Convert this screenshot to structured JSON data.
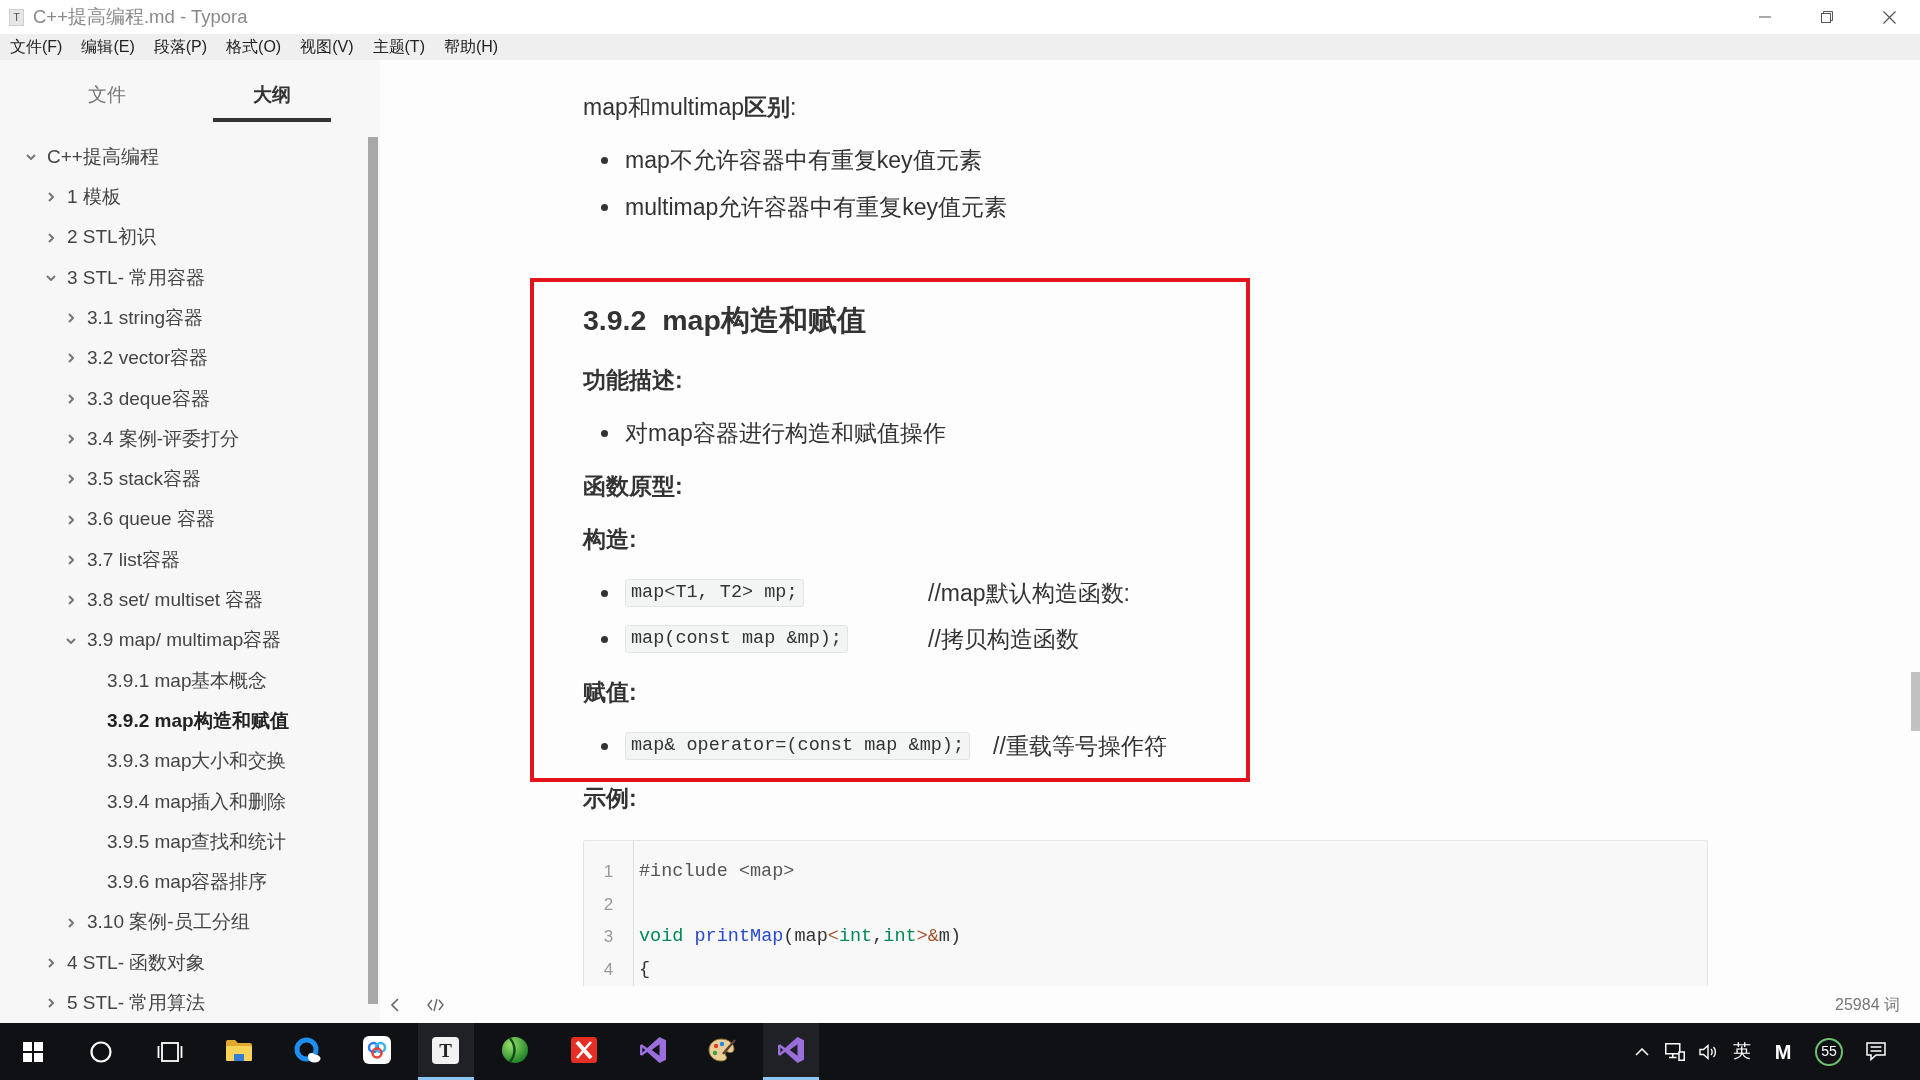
{
  "window": {
    "icon_letter": "T",
    "title": "C++提高编程.md - Typora"
  },
  "menu": [
    "文件(F)",
    "编辑(E)",
    "段落(P)",
    "格式(O)",
    "视图(V)",
    "主题(T)",
    "帮助(H)"
  ],
  "sidebar": {
    "tabs": [
      {
        "label": "文件",
        "selected": false
      },
      {
        "label": "大纲",
        "selected": true
      }
    ],
    "outline": [
      {
        "label": "C++提高编程",
        "expanded": true,
        "selected": false,
        "children": [
          {
            "label": "1 模板",
            "expanded": false,
            "selected": false
          },
          {
            "label": "2 STL初识",
            "expanded": false,
            "selected": false
          },
          {
            "label": "3 STL- 常用容器",
            "expanded": true,
            "selected": false,
            "children": [
              {
                "label": "3.1 string容器",
                "expanded": false,
                "selected": false
              },
              {
                "label": "3.2 vector容器",
                "expanded": false,
                "selected": false
              },
              {
                "label": "3.3 deque容器",
                "expanded": false,
                "selected": false
              },
              {
                "label": "3.4 案例-评委打分",
                "expanded": false,
                "selected": false
              },
              {
                "label": "3.5 stack容器",
                "expanded": false,
                "selected": false
              },
              {
                "label": "3.6 queue 容器",
                "expanded": false,
                "selected": false
              },
              {
                "label": "3.7 list容器",
                "expanded": false,
                "selected": false
              },
              {
                "label": "3.8 set/ multiset 容器",
                "expanded": false,
                "selected": false
              },
              {
                "label": "3.9 map/ multimap容器",
                "expanded": true,
                "selected": false,
                "children": [
                  {
                    "label": "3.9.1 map基本概念",
                    "selected": false
                  },
                  {
                    "label": "3.9.2 map构造和赋值",
                    "selected": true
                  },
                  {
                    "label": "3.9.3 map大小和交换",
                    "selected": false
                  },
                  {
                    "label": "3.9.4 map插入和删除",
                    "selected": false
                  },
                  {
                    "label": "3.9.5 map查找和统计",
                    "selected": false
                  },
                  {
                    "label": "3.9.6 map容器排序",
                    "selected": false
                  }
                ]
              },
              {
                "label": "3.10 案例-员工分组",
                "expanded": false,
                "selected": false
              }
            ]
          },
          {
            "label": "4 STL- 函数对象",
            "expanded": false,
            "selected": false
          },
          {
            "label": "5 STL- 常用算法",
            "expanded": false,
            "selected": false
          }
        ]
      }
    ]
  },
  "document": {
    "blocks": [
      {
        "kind": "paragraph",
        "text": "map和multimap**区别**:"
      },
      {
        "kind": "bullets",
        "items": [
          "map不允许容器中有重复key值元素",
          "multimap允许容器中有重复key值元素"
        ]
      },
      {
        "kind": "frame",
        "blocks": [
          {
            "kind": "heading",
            "text": "3.9.2  map构造和赋值"
          },
          {
            "kind": "label",
            "text": "功能描述:"
          },
          {
            "kind": "bullets",
            "items": [
              "对map容器进行构造和赋值操作"
            ]
          },
          {
            "kind": "label",
            "text": "函数原型:"
          },
          {
            "kind": "label",
            "text": "构造:"
          },
          {
            "kind": "code_bullets",
            "items": [
              {
                "code": "map<T1, T2> mp;",
                "comment": "//map默认构造函数:"
              },
              {
                "code": "map(const map &mp);",
                "comment": "//拷贝构造函数"
              }
            ]
          },
          {
            "kind": "label",
            "text": "赋值:"
          },
          {
            "kind": "code_bullets",
            "items": [
              {
                "code": "map& operator=(const map &mp);",
                "comment": "//重载等号操作符"
              }
            ]
          }
        ]
      },
      {
        "kind": "label",
        "text": "示例:"
      },
      {
        "kind": "code_block",
        "lines": [
          {
            "number": "1",
            "tokens": [
              {
                "kind": "meta",
                "text": "#include <map>"
              }
            ]
          },
          {
            "number": "2"
          },
          {
            "number": "3",
            "tokens": [
              {
                "kind": "type",
                "text": "void "
              },
              {
                "kind": "def",
                "text": "printMap"
              },
              {
                "kind": "plain",
                "text": "(map"
              },
              {
                "kind": "operator",
                "text": "<"
              },
              {
                "kind": "type",
                "text": "int"
              },
              {
                "kind": "plain",
                "text": ","
              },
              {
                "kind": "type",
                "text": "int"
              },
              {
                "kind": "operator",
                "text": ">&"
              },
              {
                "kind": "plain",
                "text": "m)"
              }
            ]
          },
          {
            "number": "4",
            "tokens": [
              {
                "kind": "plain",
                "text": "{"
              }
            ]
          }
        ]
      }
    ]
  },
  "footer": {
    "word_count": "25984 词"
  },
  "taskbar": {
    "apps": [
      {
        "kind": "folder",
        "active": false
      },
      {
        "kind": "ring_browser",
        "active": false
      },
      {
        "kind": "cloud_drive",
        "active": false
      },
      {
        "kind": "letter_tile",
        "label": "T",
        "active": true
      },
      {
        "kind": "green_sphere",
        "active": false
      },
      {
        "kind": "red_cross_tile",
        "active": false
      },
      {
        "kind": "purple_ide",
        "active": false
      },
      {
        "kind": "palette",
        "active": false
      },
      {
        "kind": "purple_ide",
        "active": true
      }
    ],
    "tray": {
      "input_method": "英",
      "app_letter": "M",
      "badge": "55"
    }
  }
}
